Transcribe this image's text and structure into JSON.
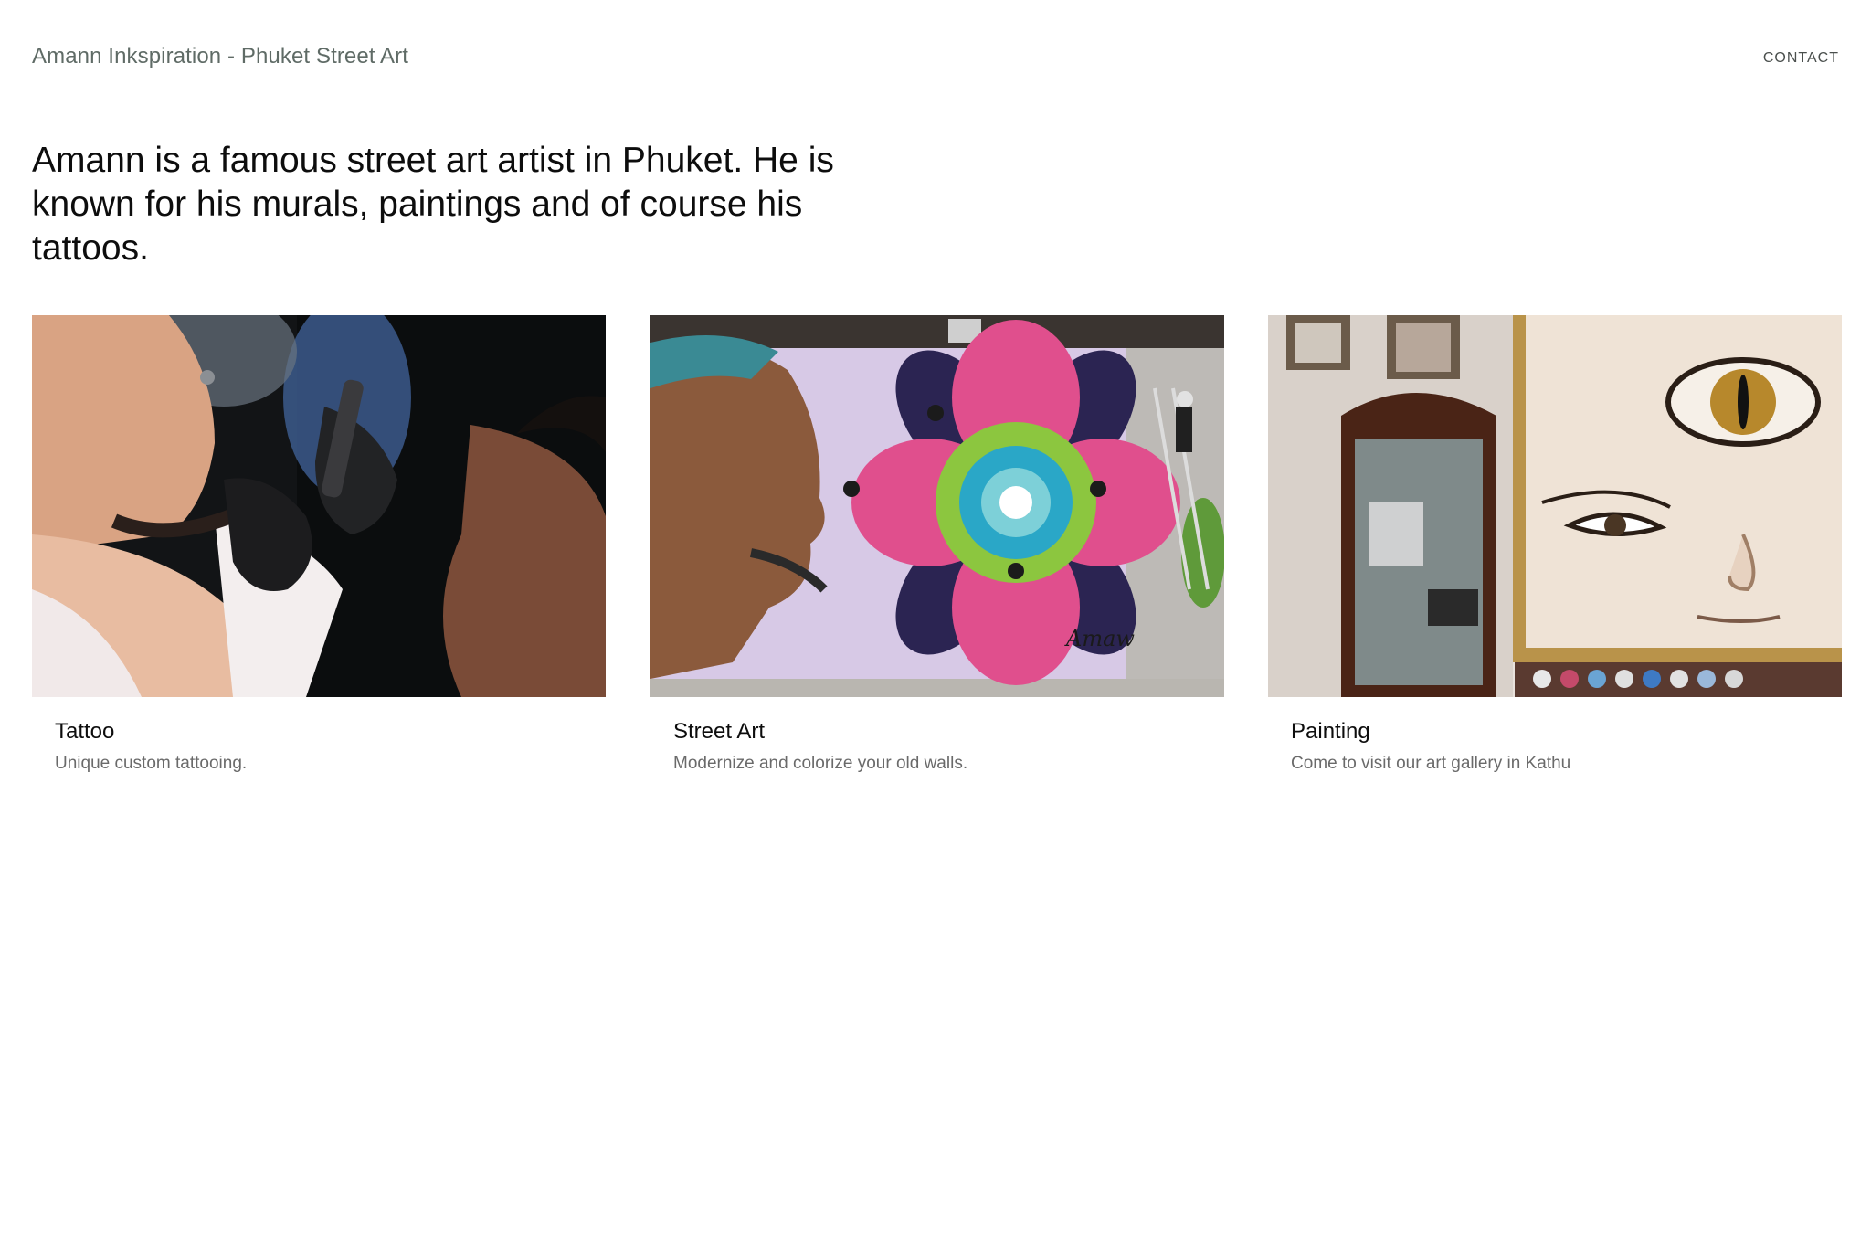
{
  "header": {
    "site_title": "Amann Inkspiration - Phuket Street Art",
    "contact_label": "CONTACT"
  },
  "intro": {
    "text": "Amann is a famous street art artist in Phuket. He is known for his murals, paintings and of course his tattoos."
  },
  "cards": [
    {
      "title": "Tattoo",
      "description": "Unique custom tattooing.",
      "image_icon": "tattoo-photo"
    },
    {
      "title": "Street Art",
      "description": "Modernize and colorize your old walls.",
      "image_icon": "mural-photo"
    },
    {
      "title": "Painting",
      "description": "Come to visit our art gallery in Kathu",
      "image_icon": "gallery-photo"
    }
  ],
  "colors": {
    "background": "#ffffff",
    "site_title": "#5f6b66",
    "body_text": "#0d0d0d",
    "muted_text": "#6a6a6a"
  }
}
